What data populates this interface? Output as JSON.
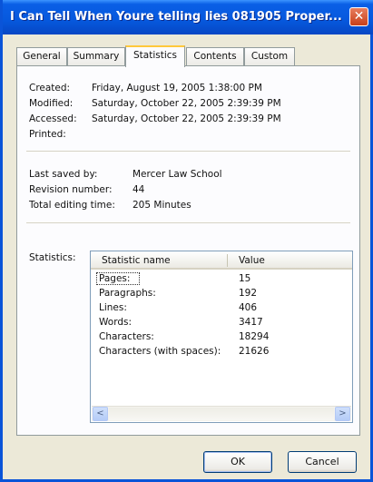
{
  "window": {
    "title": "I Can Tell When Youre telling lies 081905 Proper...",
    "close_glyph": "✕"
  },
  "tabs": [
    {
      "label": "General"
    },
    {
      "label": "Summary"
    },
    {
      "label": "Statistics",
      "active": true
    },
    {
      "label": "Contents"
    },
    {
      "label": "Custom"
    }
  ],
  "dates": {
    "created_label": "Created:",
    "created_value": "Friday, August 19, 2005 1:38:00 PM",
    "modified_label": "Modified:",
    "modified_value": "Saturday, October 22, 2005 2:39:39 PM",
    "accessed_label": "Accessed:",
    "accessed_value": "Saturday, October 22, 2005 2:39:39 PM",
    "printed_label": "Printed:"
  },
  "info": {
    "last_saved_label": "Last saved by:",
    "last_saved_value": "Mercer Law School",
    "revision_label": "Revision number:",
    "revision_value": "44",
    "editing_label": "Total editing time:",
    "editing_value": "205 Minutes"
  },
  "statistics": {
    "label": "Statistics:",
    "columns": {
      "name": "Statistic name",
      "value": "Value"
    },
    "rows": [
      {
        "name": "Pages:",
        "value": "15"
      },
      {
        "name": "Paragraphs:",
        "value": "192"
      },
      {
        "name": "Lines:",
        "value": "406"
      },
      {
        "name": "Words:",
        "value": "3417"
      },
      {
        "name": "Characters:",
        "value": "18294"
      },
      {
        "name": "Characters (with spaces):",
        "value": "21626"
      }
    ],
    "scroll_left_glyph": "<",
    "scroll_right_glyph": ">"
  },
  "buttons": {
    "ok": "OK",
    "cancel": "Cancel"
  },
  "colors": {
    "titlebar": "#0658dd",
    "active_tab_accent": "#ffc83c",
    "close_button": "#c8401a"
  }
}
